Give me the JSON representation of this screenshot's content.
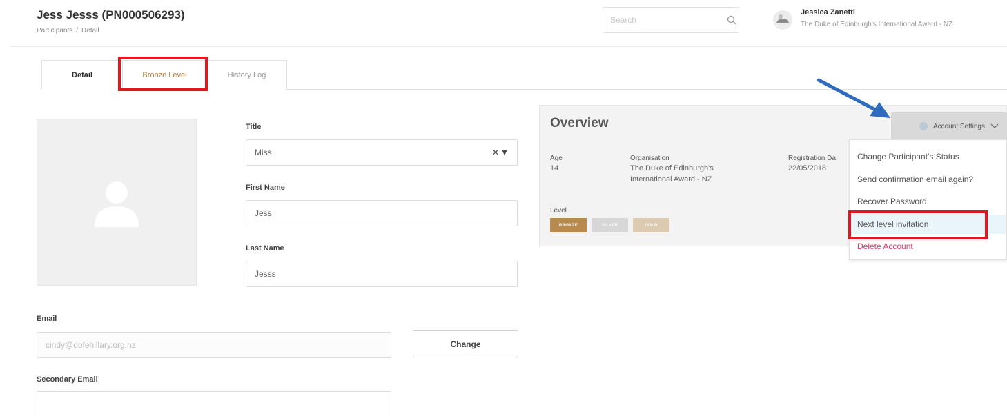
{
  "header": {
    "title": "Jess Jesss (PN000506293)",
    "breadcrumb": [
      "Participants",
      "Detail"
    ],
    "search_placeholder": "Search",
    "user_name": "Jessica Zanetti",
    "user_org": "The Duke of Edinburgh's International Award - NZ"
  },
  "tabs": [
    {
      "label": "Detail",
      "active": true
    },
    {
      "label": "Bronze Level",
      "active": false
    },
    {
      "label": "History Log",
      "active": false
    }
  ],
  "form": {
    "title_label": "Title",
    "title_value": "Miss",
    "first_name_label": "First Name",
    "first_name_value": "Jess",
    "last_name_label": "Last Name",
    "last_name_value": "Jesss",
    "email_label": "Email",
    "email_value": "cindy@dofehillary.org.nz",
    "change_label": "Change",
    "secondary_email_label": "Secondary Email",
    "secondary_email_value": ""
  },
  "overview": {
    "title": "Overview",
    "account_settings_label": "Account Settings",
    "age_label": "Age",
    "age_value": "14",
    "org_label": "Organisation",
    "org_value_line1": "The Duke of Edinburgh's",
    "org_value_line2": "International Award - NZ",
    "reg_label": "Registration Da",
    "reg_value": "22/05/2018",
    "level_label": "Level",
    "levels": [
      {
        "label": "BRONZE",
        "color": "#b98a4e"
      },
      {
        "label": "SILVER",
        "color": "#d7d7d7"
      },
      {
        "label": "GOLD",
        "color": "#dccbb0"
      }
    ]
  },
  "account_menu": [
    {
      "label": "Change Participant's Status"
    },
    {
      "label": "Send confirmation email again?"
    },
    {
      "label": "Recover Password"
    },
    {
      "label": "Next level invitation"
    },
    {
      "label": "Delete Account"
    }
  ],
  "colors": {
    "accent_red": "#e5161f",
    "arrow_blue": "#2f6bbd",
    "danger": "#e5376b"
  }
}
